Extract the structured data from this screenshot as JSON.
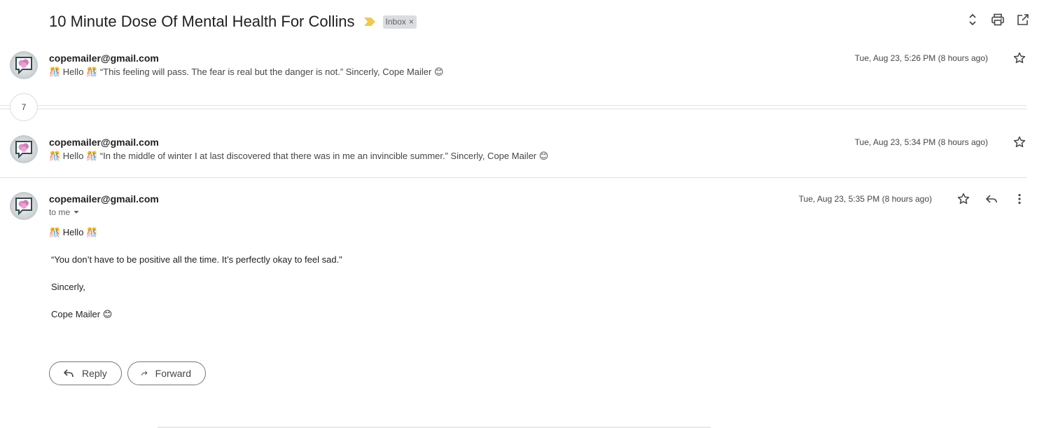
{
  "thread": {
    "subject": "10 Minute Dose Of Mental Health For Collins",
    "label": "Inbox",
    "label_remove": "×",
    "collapsed_count": "7"
  },
  "header_icons": [
    "expand-collapse-icon",
    "print-icon",
    "open-in-new-window-icon"
  ],
  "messages": [
    {
      "sender": "copemailer@gmail.com",
      "snippet": "🎊 Hello 🎊 “This feeling will pass. The fear is real but the danger is not.” Sincerly, Cope Mailer 😊",
      "date": "Tue, Aug 23, 5:26 PM (8 hours ago)"
    },
    {
      "sender": "copemailer@gmail.com",
      "snippet": "🎊 Hello 🎊 “In the middle of winter I at last discovered that there was in me an invincible summer.” Sincerly, Cope Mailer 😊",
      "date": "Tue, Aug 23, 5:34 PM (8 hours ago)"
    },
    {
      "sender": "copemailer@gmail.com",
      "recipient": "to me",
      "date": "Tue, Aug 23, 5:35 PM (8 hours ago)",
      "body": {
        "greeting": "🎊 Hello 🎊",
        "quote": "“You don’t have to be positive all the time. It’s perfectly okay to feel sad.\"",
        "closing": "Sincerly,",
        "signature": "Cope Mailer 😊"
      }
    }
  ],
  "actions": {
    "reply": "Reply",
    "forward": "Forward"
  },
  "colors": {
    "importance_marker": "#f2c94c",
    "label_chip_bg": "#dadce0",
    "divider": "#e0e0e0"
  }
}
